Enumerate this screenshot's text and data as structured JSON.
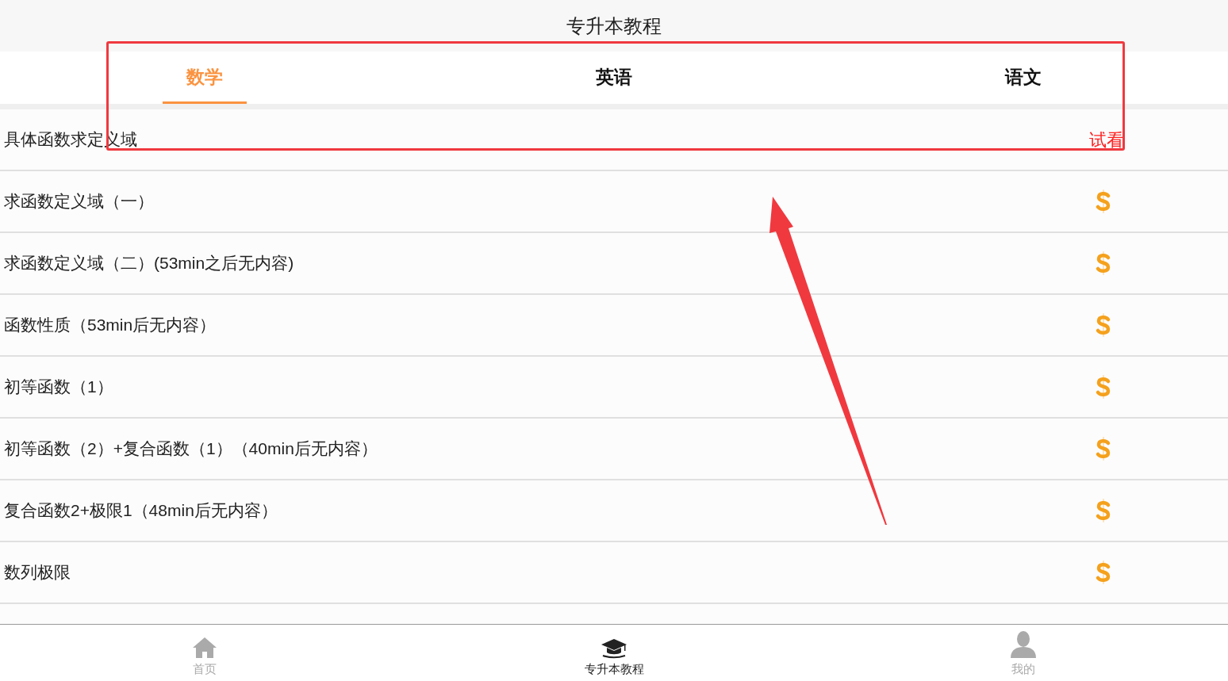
{
  "header": {
    "title": "专升本教程"
  },
  "tabs": [
    {
      "label": "数学",
      "selected": true
    },
    {
      "label": "英语",
      "selected": false
    },
    {
      "label": "语文",
      "selected": false
    }
  ],
  "lessons": [
    {
      "title": "具体函数求定义域",
      "kind": "trial",
      "badge": "试看"
    },
    {
      "title": "求函数定义域（一）",
      "kind": "paid"
    },
    {
      "title": "求函数定义域（二）(53min之后无内容)",
      "kind": "paid"
    },
    {
      "title": "函数性质（53min后无内容）",
      "kind": "paid"
    },
    {
      "title": "初等函数（1）",
      "kind": "paid"
    },
    {
      "title": "初等函数（2）+复合函数（1）（40min后无内容）",
      "kind": "paid"
    },
    {
      "title": "复合函数2+极限1（48min后无内容）",
      "kind": "paid"
    },
    {
      "title": "数列极限",
      "kind": "paid"
    }
  ],
  "bottom_nav": [
    {
      "label": "首页",
      "kind": "home",
      "selected": false
    },
    {
      "label": "专升本教程",
      "kind": "course",
      "selected": true
    },
    {
      "label": "我的",
      "kind": "profile",
      "selected": false
    }
  ]
}
